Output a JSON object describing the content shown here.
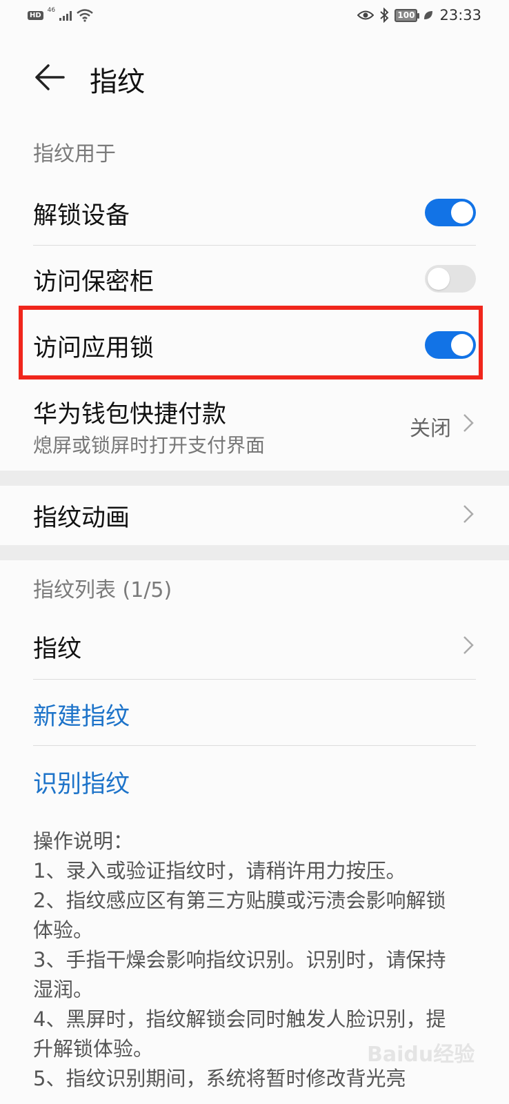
{
  "status_bar": {
    "hd": "HD",
    "network": "46",
    "battery": "100",
    "time": "23:33"
  },
  "header": {
    "title": "指纹"
  },
  "section_usage": "指纹用于",
  "toggles": [
    {
      "label": "解锁设备",
      "state": "on"
    },
    {
      "label": "访问保密柜",
      "state": "off"
    },
    {
      "label": "访问应用锁",
      "state": "on"
    }
  ],
  "wallet": {
    "label": "华为钱包快捷付款",
    "sublabel": "熄屏或锁屏时打开支付界面",
    "value": "关闭"
  },
  "animation": {
    "label": "指纹动画"
  },
  "section_list": "指纹列表 (1/5)",
  "fingerprint_item": "指纹",
  "links": {
    "new": "新建指纹",
    "identify": "识别指纹"
  },
  "notes": [
    "操作说明：",
    "1、录入或验证指纹时，请稍许用力按压。",
    "2、指纹感应区有第三方贴膜或污渍会影响解锁体验。",
    "3、手指干燥会影响指纹识别。识别时，请保持湿润。",
    "4、黑屏时，指纹解锁会同时触发人脸识别，提升解锁体验。",
    "5、指纹识别期间，系统将暂时修改背光亮"
  ],
  "watermark": "Baidu经验",
  "colors": {
    "accent": "#1273e6",
    "link": "#1d73c9",
    "highlight_border": "#f0261c"
  }
}
